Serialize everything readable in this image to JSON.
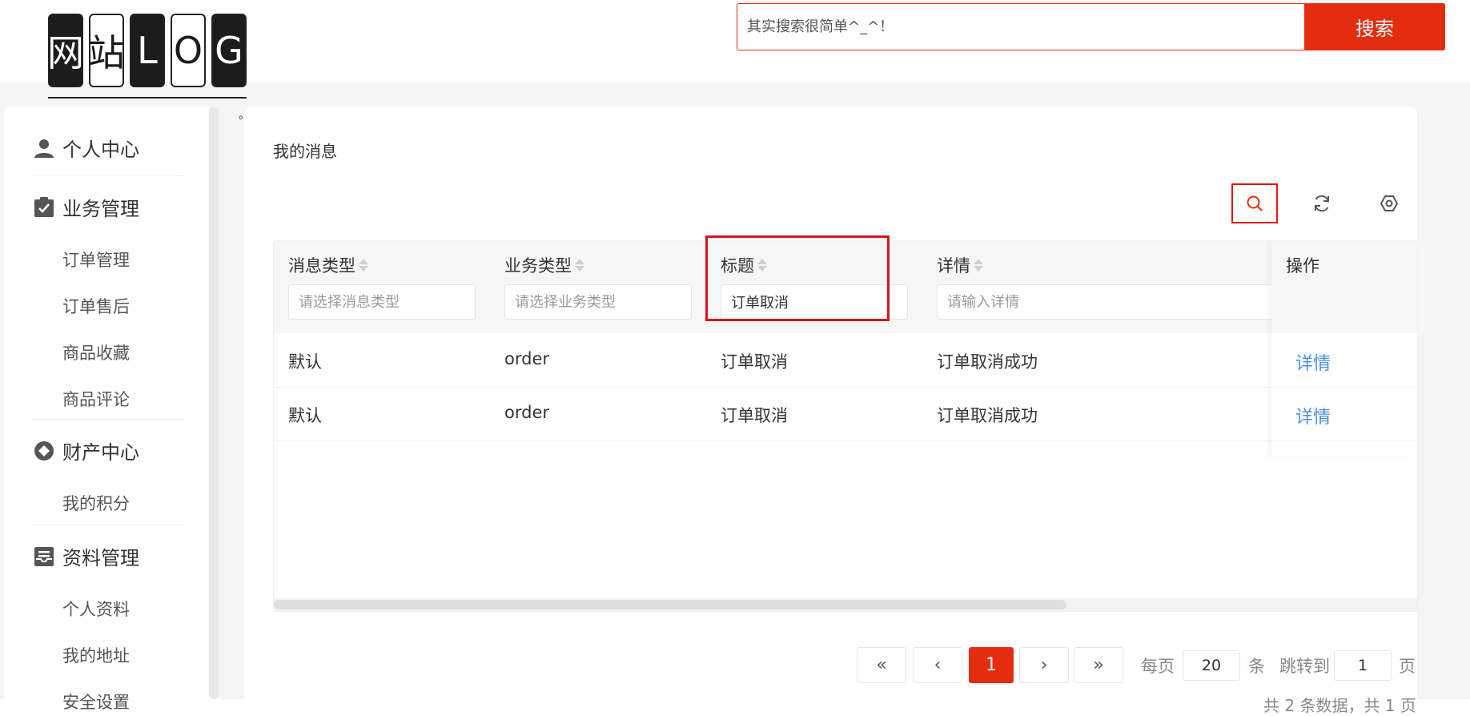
{
  "logo": {
    "chars": [
      "网",
      "站",
      "L",
      "O",
      "G"
    ],
    "dot": "。"
  },
  "search": {
    "placeholder": "其实搜索很简单^_^！",
    "button": "搜索"
  },
  "sidebar": {
    "sections": [
      {
        "icon": "user-icon",
        "label": "个人中心",
        "items": []
      },
      {
        "icon": "clipboard-check-icon",
        "label": "业务管理",
        "items": [
          "订单管理",
          "订单售后",
          "商品收藏",
          "商品评论"
        ]
      },
      {
        "icon": "asset-diamond-icon",
        "label": "财产中心",
        "items": [
          "我的积分"
        ]
      },
      {
        "icon": "profile-archive-icon",
        "label": "资料管理",
        "items": [
          "个人资料",
          "我的地址",
          "安全设置"
        ]
      }
    ]
  },
  "main": {
    "title": "我的消息",
    "toolbar": {
      "search": "search-icon",
      "refresh": "refresh-icon",
      "settings": "settings-icon"
    },
    "table": {
      "columns": [
        "消息类型",
        "业务类型",
        "标题",
        "详情",
        "操作"
      ],
      "filters": [
        {
          "placeholder": "请选择消息类型",
          "value": ""
        },
        {
          "placeholder": "请选择业务类型",
          "value": ""
        },
        {
          "placeholder": "",
          "value": "订单取消"
        },
        {
          "placeholder": "请输入详情",
          "value": ""
        }
      ],
      "rows": [
        {
          "type": "默认",
          "biz": "order",
          "title": "订单取消",
          "detail": "订单取消成功",
          "action": "详情"
        },
        {
          "type": "默认",
          "biz": "order",
          "title": "订单取消",
          "detail": "订单取消成功",
          "action": "详情"
        }
      ]
    },
    "pagination": {
      "first": "«",
      "prev": "‹",
      "current": "1",
      "next": "›",
      "last": "»",
      "per_page_label": "每页",
      "per_page_value": "20",
      "per_page_unit": "条",
      "jump_label": "跳转到",
      "jump_value": "1",
      "jump_unit": "页",
      "total": "共 2 条数据，共 1 页"
    }
  },
  "colors": {
    "accent": "#e32d0e",
    "link": "#4a90e2",
    "highlight": "#d9141a"
  }
}
